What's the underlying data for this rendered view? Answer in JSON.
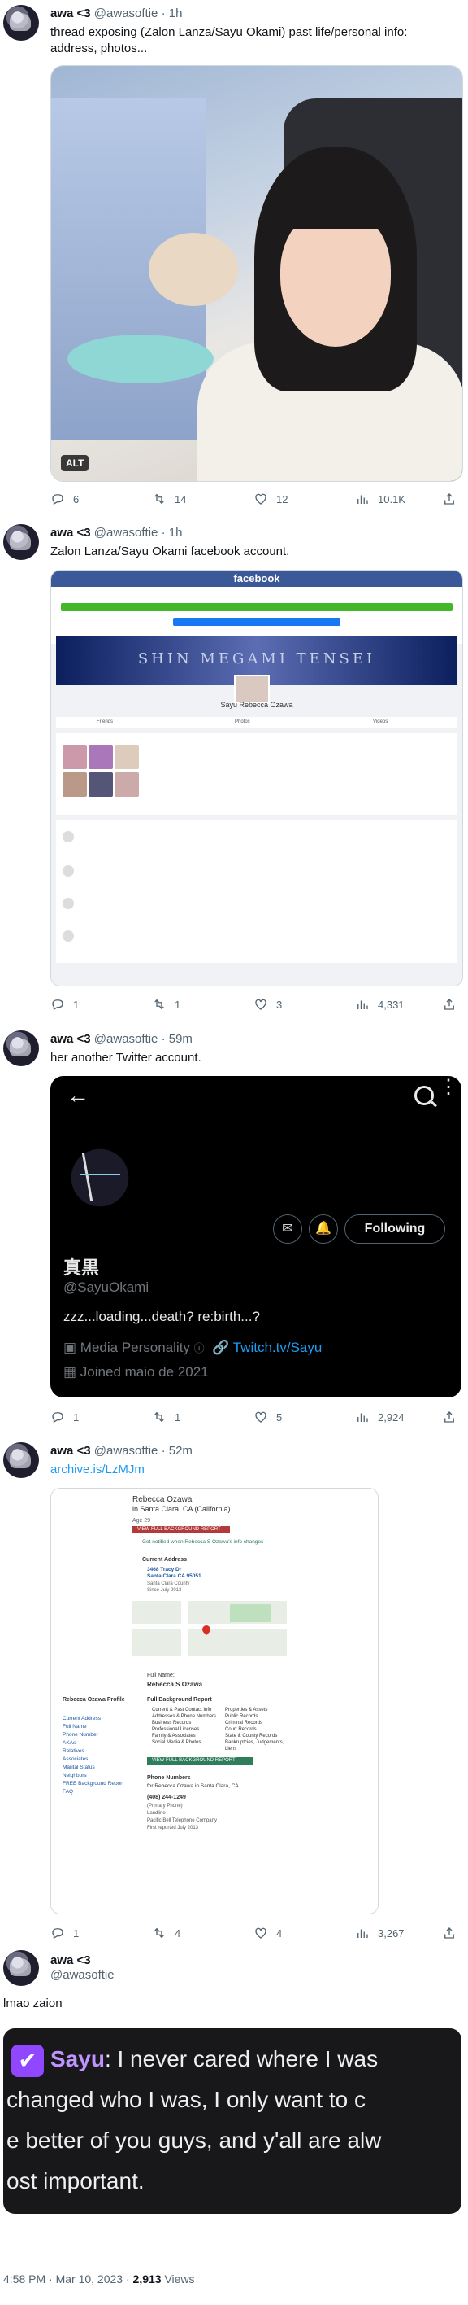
{
  "tweets": [
    {
      "name": "awa <3",
      "handle": "@awasoftie",
      "time": "1h",
      "text": "thread exposing (Zalon Lanza/Sayu Okami)  past life/personal info: address, photos...",
      "alt_badge": "ALT",
      "replies": "6",
      "retweets": "14",
      "likes": "12",
      "views": "10.1K"
    },
    {
      "name": "awa <3",
      "handle": "@awasoftie",
      "time": "1h",
      "text": "Zalon Lanza/Sayu Okami facebook account.",
      "replies": "1",
      "retweets": "1",
      "likes": "3",
      "views": "4,331"
    },
    {
      "name": "awa <3",
      "handle": "@awasoftie",
      "time": "59m",
      "text": "her another Twitter account.",
      "replies": "1",
      "retweets": "1",
      "likes": "5",
      "views": "2,924"
    },
    {
      "name": "awa <3",
      "handle": "@awasoftie",
      "time": "52m",
      "text": "archive.is/LzMJm",
      "replies": "1",
      "retweets": "4",
      "likes": "4",
      "views": "3,267"
    },
    {
      "name": "awa <3",
      "handle": "@awasoftie",
      "text": "lmao zaion"
    }
  ],
  "facebook_shot": {
    "brand": "facebook",
    "banner": "SHIN MEGAMI TENSEI",
    "profile_name": "Sayu Rebecca Ozawa",
    "tabs": [
      "Friends",
      "Photos",
      "Videos"
    ]
  },
  "twitter_profile": {
    "display_name": "真黒",
    "handle": "@SayuOkami",
    "bio": "zzz...loading...death? re:birth...?",
    "category": "Media Personality",
    "link": "Twitch.tv/Sayu",
    "joined": "Joined maio de 2021",
    "follow_button": "Following"
  },
  "archive_shot": {
    "name": "Rebecca Ozawa",
    "location": "in Santa Clara, CA (California)",
    "age": "Age 29",
    "view_report": "VIEW FULL BACKGROUND REPORT",
    "notify": "Get notified when Rebecca S Ozawa's info changes",
    "current_address_label": "Current Address",
    "address": "3468 Tracy Dr",
    "city": "Santa Clara CA 95051",
    "county": "Santa Clara County",
    "since": "Since July 2013",
    "full_name_label": "Full Name:",
    "full_name": "Rebecca S Ozawa",
    "report_label": "Full Background Report",
    "report_items_left": [
      "Current & Past Contact Info",
      "Addresses & Phone Numbers",
      "Business Records",
      "Professional Licenses",
      "Family & Associates",
      "Social Media & Photos"
    ],
    "report_items_right": [
      "Properties & Assets",
      "Public Records",
      "Criminal Records",
      "Court Records",
      "State & County Records",
      "Bankruptcies, Judgements, Liens"
    ],
    "sidebar_title": "Rebecca Ozawa Profile",
    "sidebar_links": [
      "Current Address",
      "Full Name",
      "Phone Number",
      "AKAs",
      "Relatives",
      "Associates",
      "Marital Status",
      "Neighbors",
      "FREE Background Report",
      "FAQ"
    ],
    "phone_label": "Phone Numbers",
    "phone_for": "for Rebecca Ozawa in Santa Clara, CA",
    "phone": "(408) 244-1249",
    "phone_type": "(Primary Phone)",
    "phone_line": "Landline",
    "carrier": "Pacific Bell Telephone Company",
    "reported": "First reported July 2013"
  },
  "clip": {
    "speaker": "Sayu",
    "line1": ": I never cared where I was",
    "line2": "changed who I was, I only want to c",
    "line3": "e better of you guys, and y'all are alw",
    "line4": "ost important."
  },
  "footer": {
    "timestamp": "4:58 PM · Mar 10, 2023 · ",
    "views_count": "2,913",
    "views_label": " Views"
  },
  "colors": {
    "link": "#1d9bf0",
    "text": "#0f1419",
    "grey": "#536471",
    "twitch_purple": "#bf94ff"
  }
}
